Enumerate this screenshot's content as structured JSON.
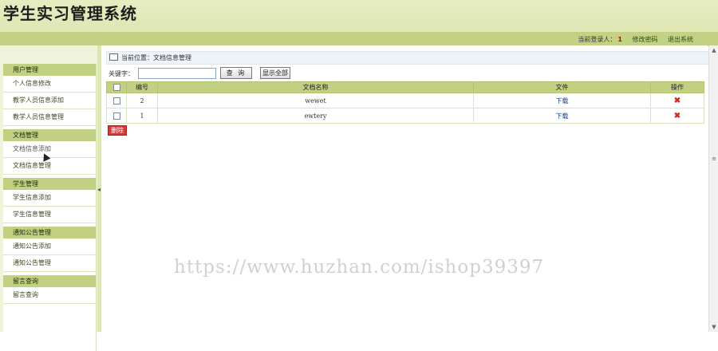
{
  "header": {
    "title": "学生实习管理系统"
  },
  "topbar": {
    "login_label": "当前登录人：",
    "login_value": "1",
    "change_password": "修改密码",
    "logout": "退出系统"
  },
  "sidebar": {
    "groups": [
      {
        "title": "用户管理",
        "items": [
          "个人信息修改",
          "教学人员信息添加",
          "教学人员信息管理"
        ]
      },
      {
        "title": "文档管理",
        "items": [
          "文档信息添加",
          "文档信息管理"
        ]
      },
      {
        "title": "学生管理",
        "items": [
          "学生信息添加",
          "学生信息管理"
        ]
      },
      {
        "title": "通知公告管理",
        "items": [
          "通知公告添加",
          "通知公告管理"
        ]
      },
      {
        "title": "留言查询",
        "items": [
          "留言查询"
        ]
      }
    ]
  },
  "main": {
    "location": "当前位置：文档信息管理",
    "search": {
      "label": "关键字：",
      "value": "",
      "query_button": "查 询",
      "show_all_button": "显示全部"
    },
    "table": {
      "headers": [
        "编号",
        "文档名称",
        "文件",
        "操作"
      ],
      "rows": [
        {
          "id": "2",
          "name": "wewet",
          "file": "下载",
          "action": "✖"
        },
        {
          "id": "1",
          "name": "ewtery",
          "file": "下载",
          "action": "✖"
        }
      ]
    },
    "delete_button": "删除"
  },
  "watermark": "https://www.huzhan.com/ishop39397"
}
